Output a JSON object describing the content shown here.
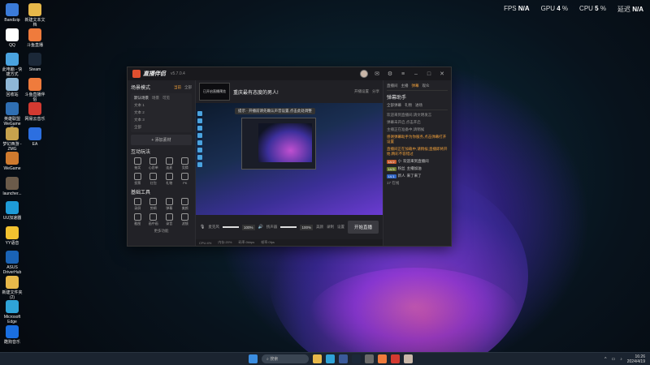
{
  "overlay": {
    "fps_label": "FPS",
    "fps_value": "N/A",
    "gpu_label": "GPU",
    "gpu_value": "4",
    "gpu_unit": "%",
    "cpu_label": "CPU",
    "cpu_value": "5",
    "cpu_unit": "%",
    "latency_label": "延迟",
    "latency_value": "N/A"
  },
  "desktop": [
    {
      "label": "Bandizip",
      "color": "#3b7bd8"
    },
    {
      "label": "QQ",
      "color": "#ffffff"
    },
    {
      "label": "此电脑 - 快捷方式",
      "color": "#4aa3df"
    },
    {
      "label": "回收站",
      "color": "#8fb7d6"
    },
    {
      "label": "英雄联盟WeGame版",
      "color": "#2f6fb3"
    },
    {
      "label": "梦幻西游 - ZMG",
      "color": "#c7a24d"
    },
    {
      "label": "WeGame",
      "color": "#cf7a2e"
    },
    {
      "label": "launcher...",
      "color": "#6b5b4a"
    },
    {
      "label": "UU加速器",
      "color": "#1e9bd7"
    },
    {
      "label": "YY语音",
      "color": "#f2c230"
    },
    {
      "label": "ASUS DriverHub",
      "color": "#1a63b5"
    },
    {
      "label": "新建文件夹 (2)",
      "color": "#e7b84a"
    },
    {
      "label": "Microsoft Edge",
      "color": "#2fa3d8"
    },
    {
      "label": "酷狗音乐",
      "color": "#1a6fe0"
    }
  ],
  "desktop2": [
    {
      "label": "新建文本文档",
      "color": "#e7b84a"
    },
    {
      "label": "斗鱼直播",
      "color": "#ef7b3c"
    },
    {
      "label": "Steam",
      "color": "#1b2838"
    },
    {
      "label": "斗鱼直播伴侣",
      "color": "#ef7b3c"
    },
    {
      "label": "网易云音乐",
      "color": "#d33a31"
    },
    {
      "label": "EA",
      "color": "#2c6fe0"
    }
  ],
  "app": {
    "name": "直播伴侣",
    "version": "v5.7.0.4",
    "room_title": "重庆最有态度的男人!",
    "live_btn": "开播设置",
    "share_btn": "分享",
    "clip_btn": "已开启直播预览",
    "scene_label": "场景模式",
    "tab_current": "当前",
    "tab_all": "全部",
    "scenes_header": "默认场景",
    "sub_tabs": [
      "场景",
      "可见"
    ],
    "sources": [
      "文本 1",
      "文本 2",
      "文本 3"
    ],
    "all_label": "全部",
    "add_source": "+ 添加素材",
    "interact_title": "互动玩法",
    "interact_items": [
      "抽奖",
      "心愿单",
      "连麦",
      "竞猜",
      "投票",
      "红包",
      "礼物",
      "PK"
    ],
    "tools_title": "基础工具",
    "tool_items": [
      "录屏",
      "剪辑",
      "弹幕",
      "美颜",
      "截图",
      "画中画",
      "录音",
      "滤镜"
    ],
    "more": "更多功能",
    "tip": "提示 · 开播前请先确认声音设置,点击此处调整",
    "mic": "麦克风",
    "speaker": "扬声器",
    "vol1": "100%",
    "vol2": "100%",
    "record": "录制",
    "beauty": "美颜",
    "settings": "设置",
    "go_live": "开始直播",
    "status_items": [
      "CPU:4%",
      "内存:20%",
      "码率:0kbps",
      "帧率:0fps"
    ],
    "right_tabs": [
      "直播间",
      "主播",
      "观众"
    ],
    "right_tab_active": "弹幕",
    "right_title": "弹幕助手",
    "right_sub": [
      "全部弹幕",
      "礼物",
      "进场"
    ],
    "notices": [
      "欢迎来到直播间,请文明发言",
      "弹幕未开启,点击开启",
      "主播正在准备中,请稍候"
    ],
    "highlight": "感谢弹幕助手为你服务,点击弹幕打开设置",
    "yellow_msg": "直播间正在加载中,请稍候;直播即将开始,精彩不容错过",
    "chats": [
      {
        "badge": "LV.2",
        "name": "小",
        "text": "欢迎来到直播间"
      },
      {
        "badge": "LV.5",
        "name": "粉丝",
        "text": "主播加油"
      },
      {
        "badge": "LV.1",
        "name": "新人",
        "text": "来了来了"
      }
    ],
    "online": "17 在线"
  },
  "taskbar": {
    "search": "搜索",
    "time": "16:26",
    "date": "2024/4/19"
  }
}
